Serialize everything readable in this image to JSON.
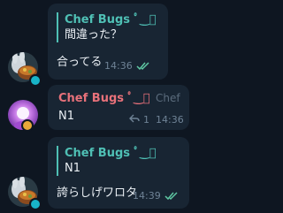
{
  "colors": {
    "background": "#0e1621",
    "bubble": "#182533",
    "quote_accent": "#4fc0b5",
    "sender_name": "#e8717a",
    "read_check": "#5fc8a4",
    "meta_text": "#6f8396"
  },
  "messages": [
    {
      "quote": {
        "name": "Chef Bugs ﾟ‿ﾟ",
        "text": "間違った？"
      },
      "text": "合ってる",
      "time": "14:36",
      "read_icon": "double-check-icon"
    },
    {
      "sender": "Chef Bugs ﾟ‿ﾟ",
      "role": "Chef",
      "text": "N1",
      "reply_count": "1",
      "reply_icon": "reply-arrow-icon",
      "time": "14:36"
    },
    {
      "quote": {
        "name": "Chef Bugs ﾟ‿ﾟ",
        "text": "N1"
      },
      "text": "誇らしげワロタ",
      "time": "14:39",
      "read_icon": "double-check-icon"
    }
  ]
}
